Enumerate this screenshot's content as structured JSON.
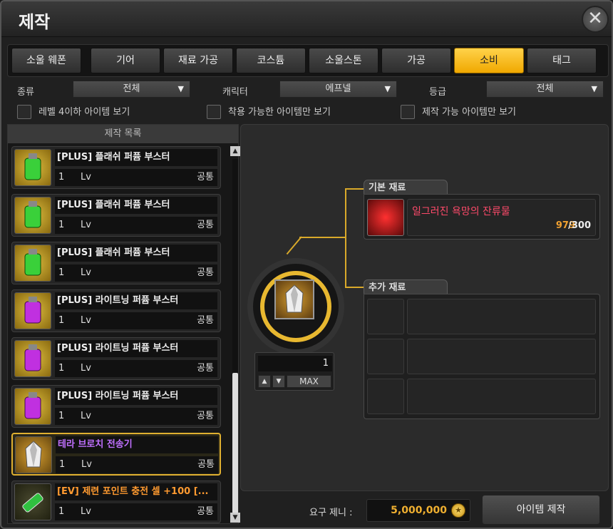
{
  "window": {
    "title": "제작"
  },
  "tabs": [
    {
      "label": "소울 웨폰"
    },
    {
      "label": "기어"
    },
    {
      "label": "재료 가공"
    },
    {
      "label": "코스튬"
    },
    {
      "label": "소울스톤"
    },
    {
      "label": "가공"
    },
    {
      "label": "소비",
      "active": true
    },
    {
      "label": "태그"
    }
  ],
  "filters": {
    "type_label": "종류",
    "type_value": "전체",
    "character_label": "캐릭터",
    "character_value": "에프넬",
    "grade_label": "등급",
    "grade_value": "전체"
  },
  "checkboxes": [
    {
      "label": "레벨 4이하 아이템 보기",
      "checked": false
    },
    {
      "label": "착용 가능한 아이템만 보기",
      "checked": false
    },
    {
      "label": "제작 가능 아이템만 보기",
      "checked": false
    }
  ],
  "list": {
    "header": "제작 목록",
    "items": [
      {
        "name": "[PLUS] 플래쉬 퍼퓸 부스터",
        "count": "1",
        "lv": "Lv",
        "class": "공통",
        "icon": "green-perfume-icon",
        "name_color": "#eeeeee"
      },
      {
        "name": "[PLUS] 플래쉬 퍼퓸 부스터",
        "count": "1",
        "lv": "Lv",
        "class": "공통",
        "icon": "green-perfume-icon",
        "name_color": "#eeeeee"
      },
      {
        "name": "[PLUS] 플래쉬 퍼퓸 부스터",
        "count": "1",
        "lv": "Lv",
        "class": "공통",
        "icon": "green-perfume-icon",
        "name_color": "#eeeeee"
      },
      {
        "name": "[PLUS] 라이트닝 퍼퓸 부스터",
        "count": "1",
        "lv": "Lv",
        "class": "공통",
        "icon": "purple-perfume-icon",
        "name_color": "#eeeeee"
      },
      {
        "name": "[PLUS] 라이트닝 퍼퓸 부스터",
        "count": "1",
        "lv": "Lv",
        "class": "공통",
        "icon": "purple-perfume-icon",
        "name_color": "#eeeeee"
      },
      {
        "name": "[PLUS] 라이트닝 퍼퓸 부스터",
        "count": "1",
        "lv": "Lv",
        "class": "공통",
        "icon": "purple-perfume-icon",
        "name_color": "#eeeeee"
      },
      {
        "name": "테라 브로치 전송기",
        "count": "1",
        "lv": "Lv",
        "class": "공통",
        "icon": "crystal-icon",
        "name_color": "#c070ff",
        "selected": true
      },
      {
        "name": "[EV] 제련 포인트 충전 셀 +100 [...",
        "count": "1",
        "lv": "Lv",
        "class": "공통",
        "icon": "battery-cell-icon",
        "name_color": "#ff9a30"
      }
    ]
  },
  "craft": {
    "quantity": "1",
    "max_label": "MAX",
    "base_material_label": "기본 재료",
    "base_material": {
      "name": "일그러진 욕망의 잔류물",
      "owned": "979",
      "required": "/300",
      "name_color": "#ff4a6a",
      "owned_color": "#f0a030"
    },
    "extra_material_label": "추가 재료",
    "zeni_label": "요구 제니 :",
    "zeni_value": "5,000,000",
    "craft_button": "아이템 제작"
  }
}
